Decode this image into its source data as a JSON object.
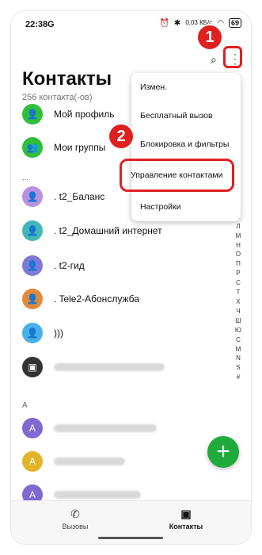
{
  "status": {
    "time": "22:38",
    "carrier_icon": "G",
    "speed": "0,03\nКБ/с",
    "battery": "69"
  },
  "header": {
    "title": "Контакты",
    "count": "256 контакта(-ов)"
  },
  "menu": {
    "items": [
      "Измен.",
      "Бесплатный вызов",
      "Блокировка и фильтры",
      "Управление контактами",
      "Настройки"
    ]
  },
  "badges": {
    "one": "1",
    "two": "2"
  },
  "contacts": [
    {
      "label": "Мой профиль",
      "color": "#2fbf3b"
    },
    {
      "label": "Мои группы",
      "color": "#2fbf3b"
    },
    {
      "section": "..."
    },
    {
      "label": ". t2_Баланс",
      "color": "#b892e0"
    },
    {
      "label": ". t2_Домашний интернет",
      "color": "#43b6b8"
    },
    {
      "label": ". t2-гид",
      "color": "#7e7bd7"
    },
    {
      "label": ". Tele2-Абонслужба",
      "color": "#e08a3b"
    },
    {
      "label": ")))",
      "color": "#4ab0e8"
    },
    {
      "label": "",
      "color": "#333333"
    },
    {
      "section": "А"
    },
    {
      "label": "",
      "color": "#7e6ad0"
    },
    {
      "label": "",
      "color": "#e3b429"
    },
    {
      "label": "",
      "color": "#7e6ad0"
    }
  ],
  "index_letters": "Ц\nИ\nК\nЛ\nМ\nН\nО\nП\nР\nС\nТ\nХ\nЧ\nШ\nЮ\nС\nM\nN\nS\n#",
  "fab": {
    "label": "+"
  },
  "bottom_nav": {
    "calls": "Вызовы",
    "contacts": "Контакты"
  }
}
